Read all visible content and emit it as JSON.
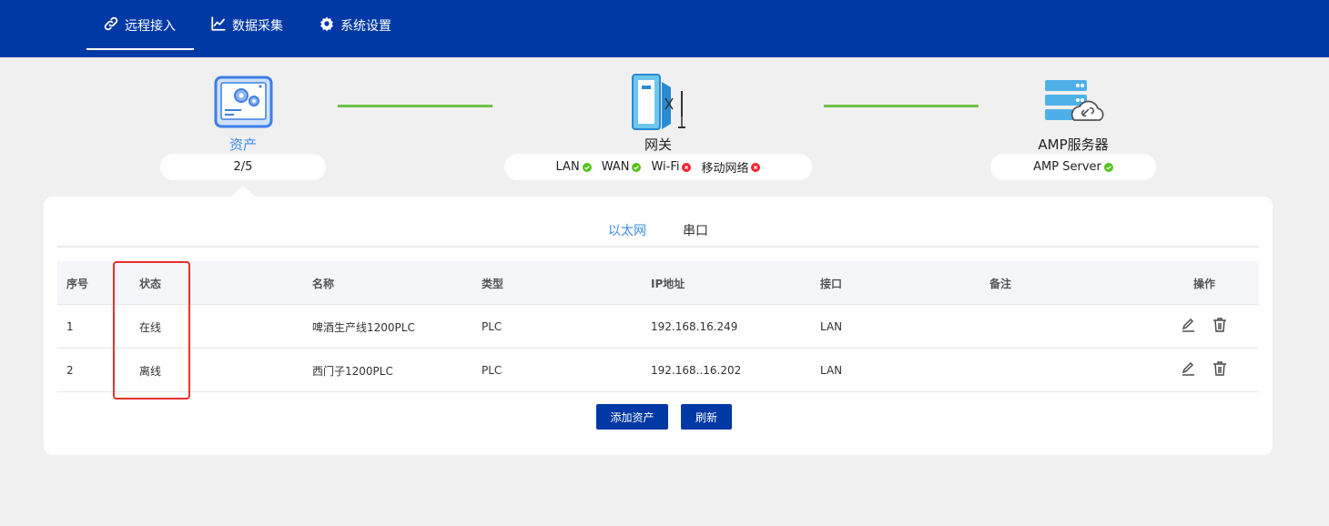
{
  "nav": {
    "items": [
      {
        "label": "远程接入",
        "icon": "link-icon",
        "active": true
      },
      {
        "label": "数据采集",
        "icon": "chart-line-icon",
        "active": false
      },
      {
        "label": "系统设置",
        "icon": "gear-icon",
        "active": false
      }
    ]
  },
  "topology": {
    "asset": {
      "title": "资产",
      "count": "2/5",
      "icon": "asset-device-icon"
    },
    "gateway": {
      "title": "网关",
      "icon": "gateway-device-icon",
      "statuses": [
        {
          "label": "LAN",
          "ok": true
        },
        {
          "label": "WAN",
          "ok": true
        },
        {
          "label": "Wi-Fi",
          "ok": false
        },
        {
          "label": "移动网络",
          "ok": false
        }
      ]
    },
    "server": {
      "title": "AMP服务器",
      "icon": "server-cloud-icon",
      "status": {
        "label": "AMP Server",
        "ok": true
      }
    },
    "colors": {
      "link": "#6cc04a",
      "ok": "#52c41a",
      "error": "#f5222d"
    }
  },
  "tabs": [
    {
      "label": "以太网",
      "active": true
    },
    {
      "label": "串口",
      "active": false
    }
  ],
  "table": {
    "headers": [
      "序号",
      "状态",
      "名称",
      "类型",
      "IP地址",
      "接口",
      "备注",
      "操作"
    ],
    "rows": [
      {
        "index": "1",
        "status": "在线",
        "name": "啤酒生产线1200PLC",
        "type": "PLC",
        "ip": "192.168.16.249",
        "port": "LAN",
        "note": ""
      },
      {
        "index": "2",
        "status": "离线",
        "name": "西门子1200PLC",
        "type": "PLC",
        "ip": "192.168..16.202",
        "port": "LAN",
        "note": ""
      }
    ]
  },
  "buttons": {
    "add": "添加资产",
    "refresh": "刷新"
  },
  "theme": {
    "primary": "#0039a6",
    "accent": "#3d8ee6",
    "highlight": "#e6312d"
  }
}
